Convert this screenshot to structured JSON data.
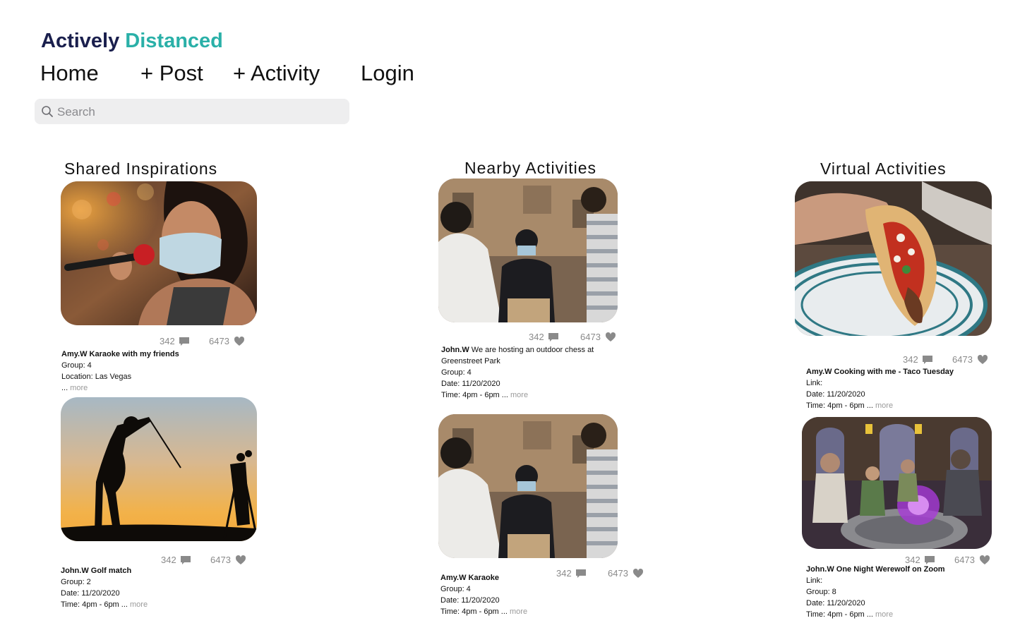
{
  "brand": {
    "part1": "Actively",
    "part2": "Distanced"
  },
  "nav": {
    "home": "Home",
    "post": "+ Post",
    "activity": "+ Activity",
    "login": "Login"
  },
  "search": {
    "placeholder": "Search",
    "value": ""
  },
  "columns": {
    "shared": "Shared Inspirations",
    "nearby": "Nearby Activities",
    "virtual": "Virtual Activities"
  },
  "icons": {
    "comment": "comment-icon",
    "like": "heart-icon",
    "search": "search-icon"
  },
  "colors": {
    "brand_dark": "#1a1f4d",
    "brand_blue": "#3a63e6",
    "brand_teal": "#2ab0a8",
    "search_bg": "#eeeeef"
  },
  "cards": {
    "c1": {
      "image": "karaoke-singer-photo",
      "comments": "342",
      "likes": "6473",
      "user": "Amy.W",
      "title": "Karaoke with my friends",
      "line2": "Group: 4",
      "line3": "Location: Las Vegas",
      "ellipsis": " ... ",
      "more": "more"
    },
    "c2": {
      "image": "golf-silhouette-photo",
      "comments": "342",
      "likes": "6473",
      "user": "John.W",
      "title": "Golf match",
      "line2": "Group: 2",
      "line3": "Date: 11/20/2020",
      "line4": "Time: 4pm - 6pm ... ",
      "more": "more"
    },
    "c3": {
      "image": "outdoor-chess-photo",
      "comments": "342",
      "likes": "6473",
      "user": "John.W",
      "text1": "We are hosting an outdoor chess at",
      "text2": "Greenstreet Park",
      "line2": "Group: 4",
      "line3": "Date: 11/20/2020",
      "line4": "Time: 4pm - 6pm ... ",
      "more": "more"
    },
    "c4": {
      "image": "outdoor-chess-photo",
      "comments": "342",
      "likes": "6473",
      "user": "Amy.W",
      "title": "Karaoke",
      "line2": "Group: 4",
      "line3": "Date: 11/20/2020",
      "line4": "Time: 4pm - 6pm ... ",
      "more": "more"
    },
    "c5": {
      "image": "taco-photo",
      "comments": "342",
      "likes": "6473",
      "user": "Amy.W",
      "title": "Cooking with me - Taco Tuesday",
      "line2": "Link:",
      "line3": "Date: 11/20/2020",
      "line4": "Time: 4pm - 6pm ... ",
      "more": "more"
    },
    "c6": {
      "image": "werewolf-game-screenshot",
      "comments": "342",
      "likes": "6473",
      "user": "John.W",
      "title": "One Night Werewolf on Zoom",
      "line2": "Link:",
      "line3": "Group: 8",
      "line4": "Date: 11/20/2020",
      "line5": "Time: 4pm - 6pm ... ",
      "more": "more"
    }
  }
}
